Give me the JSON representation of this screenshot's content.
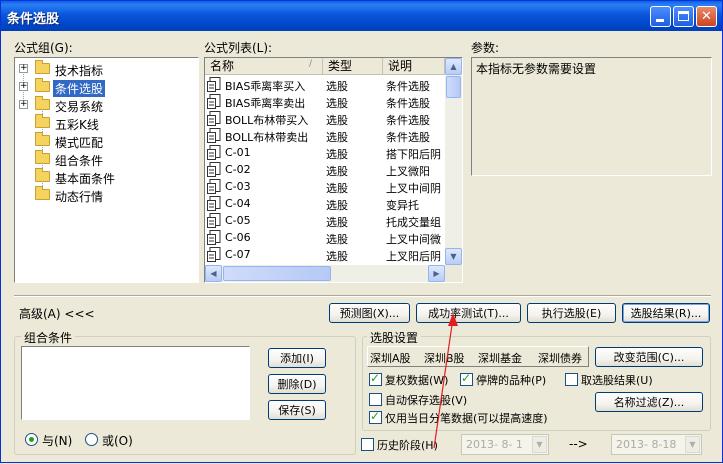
{
  "window": {
    "title": "条件选股"
  },
  "labels": {
    "formula_group": "公式组(G):",
    "formula_list": "公式列表(L):",
    "params": "参数:",
    "combo_conditions": "组合条件",
    "stock_settings": "选股设置",
    "advanced": "高级(A) <<<"
  },
  "tree": {
    "items": [
      {
        "label": "技术指标",
        "expandable": true,
        "selected": false
      },
      {
        "label": "条件选股",
        "expandable": true,
        "selected": true
      },
      {
        "label": "交易系统",
        "expandable": true,
        "selected": false
      },
      {
        "label": "五彩K线",
        "expandable": false,
        "selected": false
      },
      {
        "label": "模式匹配",
        "expandable": false,
        "selected": false
      },
      {
        "label": "组合条件",
        "expandable": false,
        "selected": false
      },
      {
        "label": "基本面条件",
        "expandable": false,
        "selected": false
      },
      {
        "label": "动态行情",
        "expandable": false,
        "selected": false
      }
    ]
  },
  "formula_table": {
    "columns": [
      "名称",
      "类型",
      "说明"
    ],
    "rows": [
      [
        "BIAS乖离率买入",
        "选股",
        "条件选股"
      ],
      [
        "BIAS乖离率卖出",
        "选股",
        "条件选股"
      ],
      [
        "BOLL布林带买入",
        "选股",
        "条件选股"
      ],
      [
        "BOLL布林带卖出",
        "选股",
        "条件选股"
      ],
      [
        "C-01",
        "选股",
        "搭下阳后阴"
      ],
      [
        "C-02",
        "选股",
        "上叉微阳"
      ],
      [
        "C-03",
        "选股",
        "上叉中间阴"
      ],
      [
        "C-04",
        "选股",
        "变异托"
      ],
      [
        "C-05",
        "选股",
        "托成交量组"
      ],
      [
        "C-06",
        "选股",
        "上叉中间微"
      ],
      [
        "C-07",
        "选股",
        "上叉阳后阴"
      ]
    ]
  },
  "params_text": "本指标无参数需要设置",
  "buttons": {
    "predict": "预测图(X)...",
    "success_test": "成功率测试(T)...",
    "execute": "执行选股(E)",
    "results": "选股结果(R)...",
    "add": "添加(I)",
    "delete": "删除(D)",
    "save": "保存(S)",
    "change_range": "改变范围(C)...",
    "name_filter": "名称过滤(Z)..."
  },
  "markets": [
    "深圳A股",
    "深圳B股",
    "深圳基金",
    "深圳债券"
  ],
  "options": {
    "restore_rights": {
      "label": "复权数据(W)",
      "checked": true
    },
    "suspended": {
      "label": "停牌的品种(P)",
      "checked": true
    },
    "take_results": {
      "label": "取选股结果(U)",
      "checked": false
    },
    "auto_save": {
      "label": "自动保存选股(V)",
      "checked": false
    },
    "last_day_only": {
      "label": "仅用当日分笔数据(可以提高速度)",
      "checked": true
    },
    "history": {
      "label": "历史阶段(H)",
      "checked": false
    }
  },
  "logic": {
    "and": "与(N)",
    "or": "或(O)",
    "selected": "and"
  },
  "dates": {
    "start": "2013- 8- 1",
    "end": "2013- 8-18",
    "separator": "-->"
  }
}
